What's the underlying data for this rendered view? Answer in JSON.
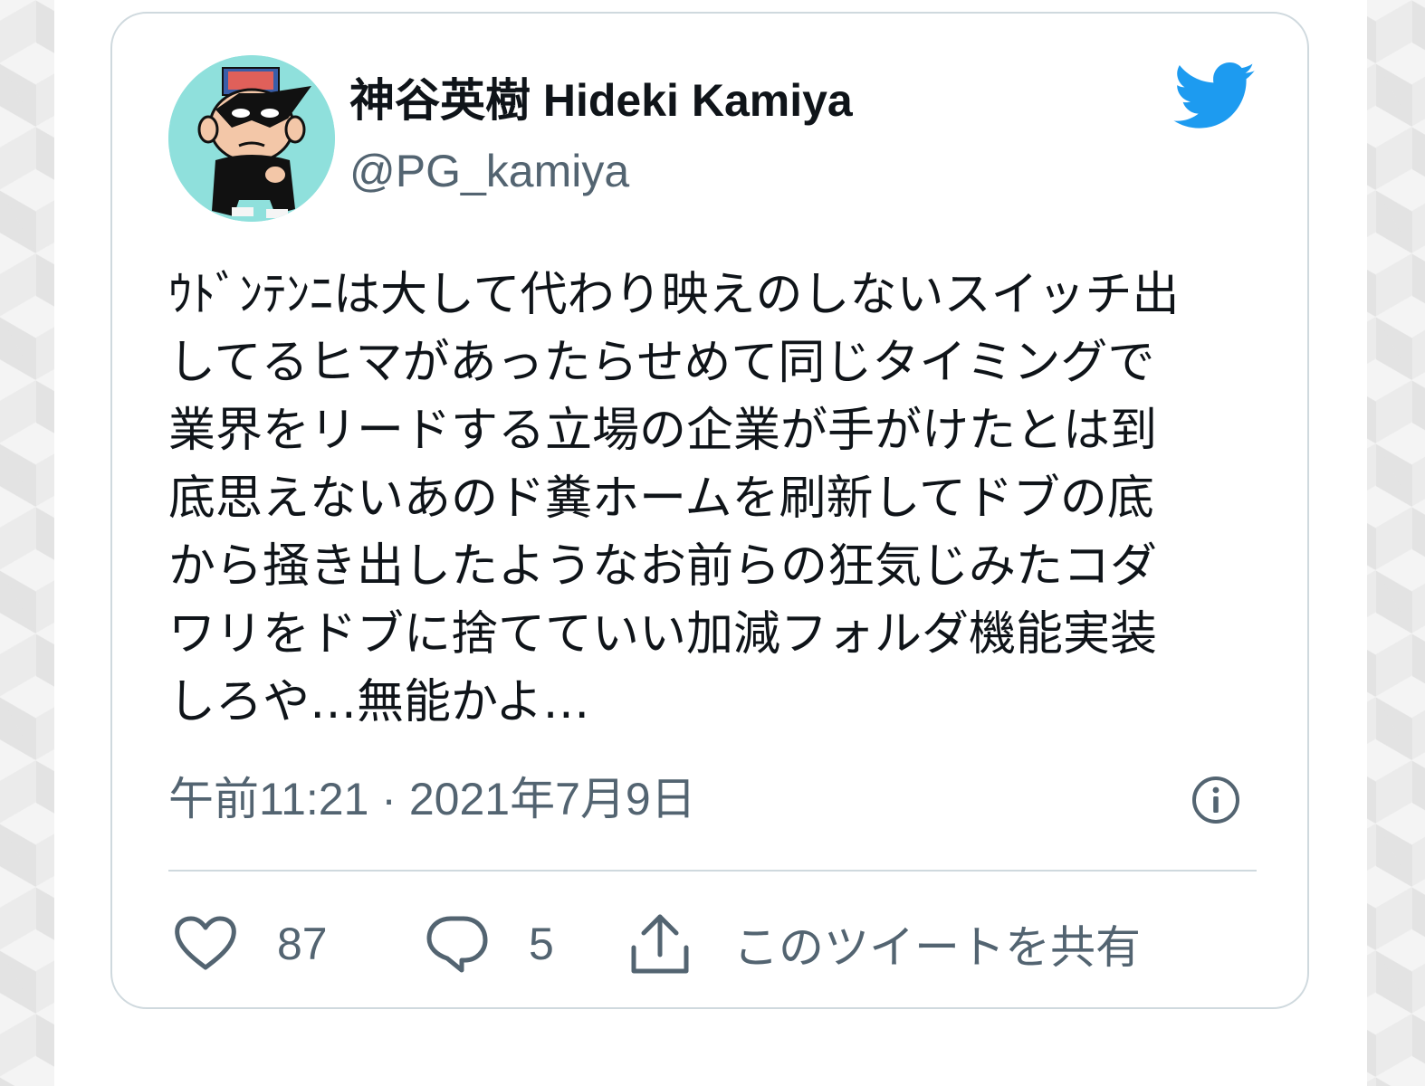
{
  "tweet": {
    "author": {
      "display_name": "神谷英樹 Hideki Kamiya",
      "handle": "@PG_kamiya",
      "avatar_icon": "avatar-cartoon-masked-character-icon"
    },
    "brand_icon": "twitter-bird-icon",
    "text": "ｳﾄﾞﾝﾃﾝﾆは大して代わり映えのしないスイッチ出\nしてるヒマがあったらせめて同じタイミングで\n業界をリードする立場の企業が手がけたとは到\n底思えないあのド糞ホームを刷新してドブの底\nから掻き出したようなお前らの狂気じみたコダ\nワリをドブに捨てていい加減フォルダ機能実装\nしろや…無能かよ…",
    "timestamp": "午前11:21 · 2021年7月9日",
    "info_icon": "info-icon",
    "actions": {
      "like_icon": "heart-icon",
      "like_count": "87",
      "reply_icon": "reply-bubble-icon",
      "reply_count": "5",
      "share_icon": "share-upload-icon",
      "share_label": "このツイートを共有"
    }
  },
  "colors": {
    "twitter_blue": "#1d9bf0",
    "primary_text": "#0f1419",
    "secondary_text": "#536471",
    "border": "#cfd9de",
    "avatar_background": "#8fe0dc"
  }
}
